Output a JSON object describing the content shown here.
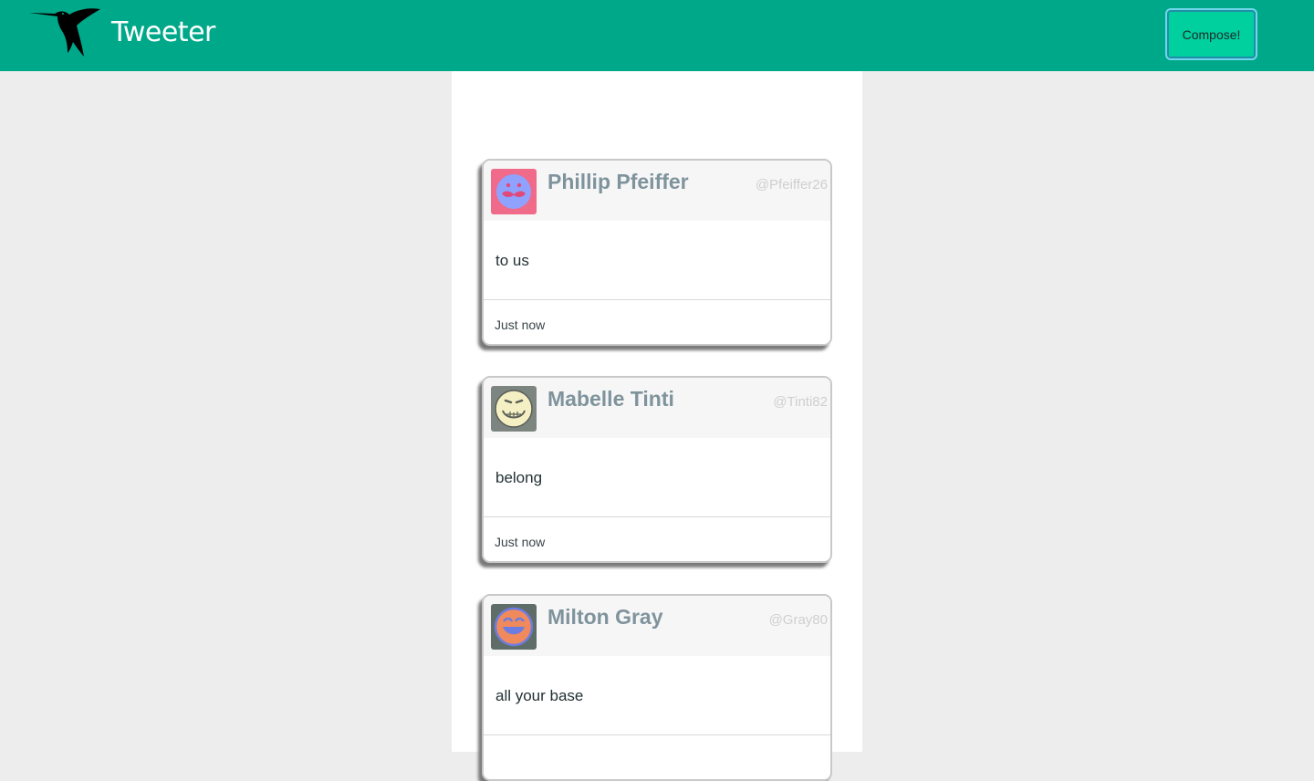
{
  "navbar": {
    "brand": "Tweeter",
    "compose_label": "Compose!",
    "logo_icon": "hummingbird-icon",
    "background": "#00a88a",
    "compose_color": "#00cf9e"
  },
  "tweets": [
    {
      "name": "Phillip Pfeiffer",
      "handle": "@Pfeiffer26",
      "text": "to us",
      "time": "Just now",
      "avatar_icon": "mustache-face-avatar-icon",
      "avatar_bg": "#f06a8a",
      "avatar_face": "#8fa2ff"
    },
    {
      "name": "Mabelle Tinti",
      "handle": "@Tinti82",
      "text": "belong",
      "time": "Just now",
      "avatar_icon": "grinning-face-avatar-icon",
      "avatar_bg": "#7d8580",
      "avatar_face": "#f5f0c3"
    },
    {
      "name": "Milton Gray",
      "handle": "@Gray80",
      "text": "all your base",
      "time": "",
      "avatar_icon": "laughing-face-avatar-icon",
      "avatar_bg": "#5f6d68",
      "avatar_face": "#f08a5d"
    }
  ]
}
